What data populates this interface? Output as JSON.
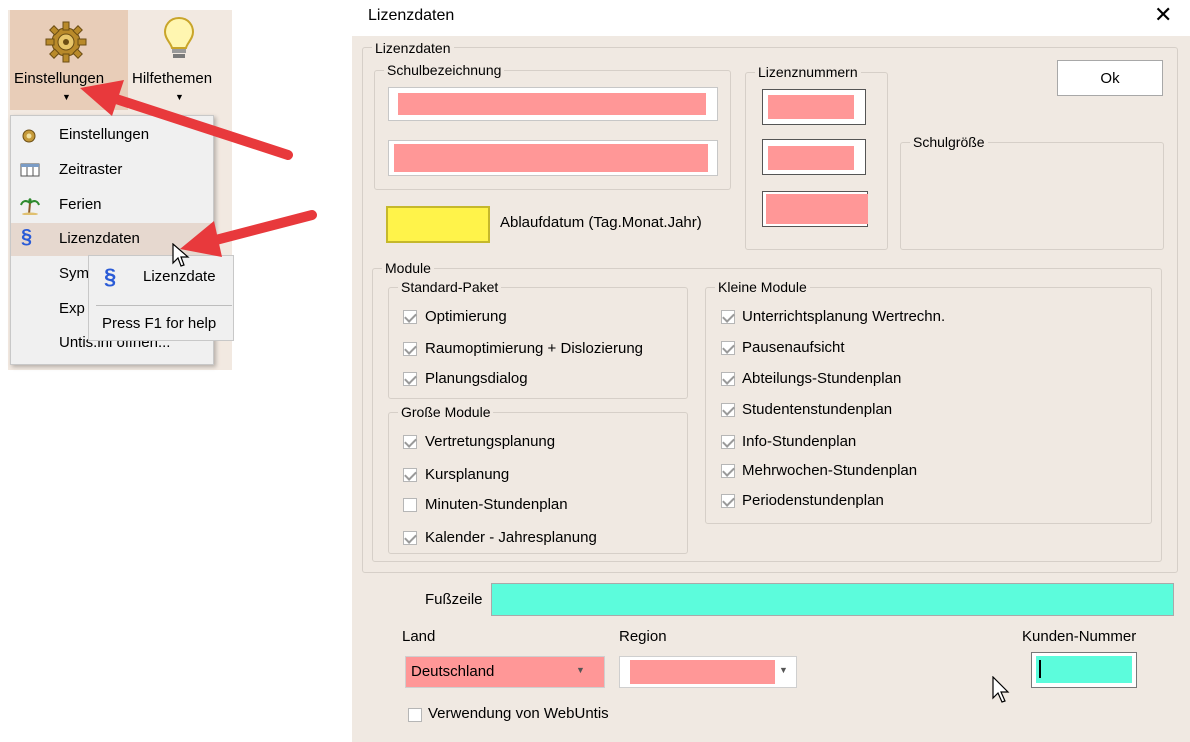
{
  "ribbon": {
    "einstellungen_label": "Einstellungen",
    "hilfethemen_label": "Hilfethemen"
  },
  "menu": {
    "items": [
      {
        "label": "Einstellungen",
        "icon": "gear-icon"
      },
      {
        "label": "Zeitraster",
        "icon": "grid-table-icon"
      },
      {
        "label": "Ferien",
        "icon": "palm-tree-icon"
      },
      {
        "label": "Lizenzdaten",
        "icon": "license-s-icon"
      },
      {
        "label": "Sym",
        "icon": ""
      },
      {
        "label": "Exp",
        "icon": ""
      },
      {
        "label": "Untis.ini öffnen...",
        "icon": ""
      }
    ],
    "submenu_label": "Lizenzdate",
    "tooltip": "Press F1 for help"
  },
  "dialog": {
    "title": "Lizenzdaten",
    "close": "✕",
    "ok_label": "Ok",
    "group_lizenzdaten": "Lizenzdaten",
    "group_schulbezeichnung": "Schulbezeichnung",
    "group_lizenznummern": "Lizenznummern",
    "group_schulgroesse": "Schulgröße",
    "ablaufdatum_label": "Ablaufdatum (Tag.Monat.Jahr)",
    "group_module": "Module",
    "group_standard": "Standard-Paket",
    "group_grosse": "Große Module",
    "group_kleine": "Kleine Module",
    "standard": [
      {
        "label": "Optimierung",
        "checked": true
      },
      {
        "label": "Raumoptimierung + Dislozierung",
        "checked": true
      },
      {
        "label": "Planungsdialog",
        "checked": true
      }
    ],
    "grosse": [
      {
        "label": "Vertretungsplanung",
        "checked": true
      },
      {
        "label": "Kursplanung",
        "checked": true
      },
      {
        "label": "Minuten-Stundenplan",
        "checked": false
      },
      {
        "label": "Kalender - Jahresplanung",
        "checked": true
      }
    ],
    "kleine": [
      {
        "label": "Unterrichtsplanung Wertrechn.",
        "checked": true
      },
      {
        "label": "Pausenaufsicht",
        "checked": true
      },
      {
        "label": "Abteilungs-Stundenplan",
        "checked": true
      },
      {
        "label": "Studentenstundenplan",
        "checked": true
      },
      {
        "label": "Info-Stundenplan",
        "checked": true
      },
      {
        "label": "Mehrwochen-Stundenplan",
        "checked": true
      },
      {
        "label": "Periodenstundenplan",
        "checked": true
      }
    ],
    "fusszeile_label": "Fußzeile",
    "land_label": "Land",
    "land_value": "Deutschland",
    "region_label": "Region",
    "kunden_label": "Kunden-Nummer",
    "webuntis_label": "Verwendung von WebUntis",
    "colors": {
      "redacted": "#ff9797",
      "date": "#fff34a",
      "teal": "#5cfcdc",
      "arrow": "#e8393c"
    }
  }
}
